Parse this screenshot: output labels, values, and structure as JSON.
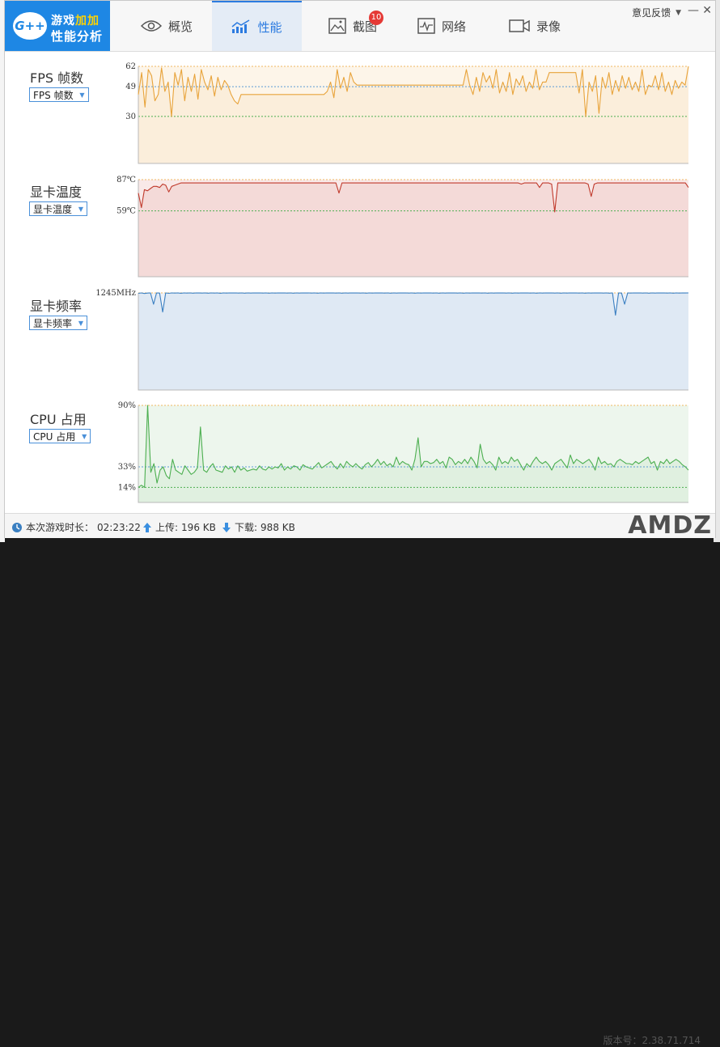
{
  "app": {
    "logo_badge": "G++",
    "logo_line1_a": "游戏",
    "logo_line1_b": "加加",
    "logo_line2": "性能分析"
  },
  "tabs": [
    {
      "label": "概览",
      "icon": "eye-icon"
    },
    {
      "label": "性能",
      "icon": "performance-chart-icon",
      "active": true
    },
    {
      "label": "截图",
      "icon": "screenshot-image-icon",
      "badge": "10"
    },
    {
      "label": "网络",
      "icon": "network-pulse-icon"
    },
    {
      "label": "录像",
      "icon": "video-camera-icon"
    }
  ],
  "header": {
    "feedback": "意见反馈",
    "minimize": "—",
    "close": "✕"
  },
  "sections": [
    {
      "label": "FPS 帧数",
      "select": "FPS 帧数",
      "color": "#e8a33a",
      "fill": "#fdf5e9",
      "refs": [
        {
          "label": "62",
          "value": 62,
          "color": "#f0b860"
        },
        {
          "label": "49",
          "value": 49,
          "color": "#5b9bd5"
        },
        {
          "label": "30",
          "value": 30,
          "color": "#4caf50"
        }
      ],
      "ylim": [
        0,
        62
      ],
      "values": [
        44,
        58,
        36,
        60,
        56,
        40,
        44,
        61,
        46,
        52,
        30,
        58,
        50,
        60,
        40,
        55,
        46,
        57,
        41,
        60,
        52,
        47,
        56,
        43,
        55,
        47,
        53,
        50,
        44,
        40,
        38,
        44,
        44,
        44,
        44,
        44,
        44,
        44,
        44,
        44,
        44,
        44,
        44,
        44,
        44,
        44,
        44,
        44,
        44,
        44,
        44,
        44,
        44,
        44,
        44,
        44,
        44,
        46,
        52,
        42,
        60,
        48,
        55,
        46,
        58,
        52,
        50,
        50,
        50,
        50,
        50,
        50,
        50,
        50,
        50,
        50,
        50,
        50,
        50,
        50,
        50,
        50,
        50,
        50,
        50,
        50,
        50,
        50,
        50,
        50,
        50,
        50,
        50,
        50,
        50,
        50,
        50,
        50,
        50,
        60,
        50,
        44,
        55,
        46,
        58,
        52,
        56,
        48,
        60,
        45,
        52,
        46,
        58,
        44,
        54,
        50,
        56,
        46,
        52,
        48,
        60,
        47,
        52,
        52,
        58,
        58,
        58,
        58,
        58,
        58,
        58,
        58,
        58,
        45,
        60,
        30,
        52,
        46,
        56,
        32,
        55,
        48,
        58,
        44,
        53,
        46,
        56,
        48,
        55,
        47,
        52,
        46,
        60,
        44,
        50,
        49,
        56,
        47,
        58,
        46,
        52,
        44,
        53,
        48,
        52,
        50,
        62
      ]
    },
    {
      "label": "显卡温度",
      "select": "显卡温度",
      "color": "#c0392b",
      "fill": "#f9e9e8",
      "refs": [
        {
          "label": "87℃",
          "value": 87,
          "color": "#f0b860"
        },
        {
          "label": "59℃",
          "value": 59,
          "color": "#4caf50"
        }
      ],
      "ylim": [
        0,
        87
      ],
      "values": [
        75,
        62,
        78,
        77,
        79,
        81,
        81,
        80,
        83,
        82,
        76,
        81,
        82,
        83,
        84,
        84,
        84,
        84,
        84,
        84,
        84,
        84,
        84,
        84,
        84,
        84,
        84,
        84,
        84,
        84,
        84,
        84,
        84,
        84,
        84,
        84,
        84,
        84,
        84,
        84,
        84,
        84,
        84,
        84,
        84,
        84,
        84,
        84,
        84,
        84,
        84,
        84,
        84,
        84,
        84,
        84,
        84,
        84,
        84,
        84,
        84,
        84,
        84,
        84,
        84,
        84,
        75,
        84,
        84,
        84,
        84,
        84,
        84,
        84,
        84,
        84,
        84,
        84,
        84,
        84,
        84,
        84,
        84,
        84,
        84,
        84,
        84,
        84,
        84,
        84,
        84,
        84,
        84,
        84,
        84,
        84,
        84,
        84,
        84,
        84,
        84,
        84,
        84,
        84,
        84,
        84,
        84,
        84,
        84,
        84,
        84,
        84,
        84,
        84,
        84,
        84,
        84,
        84,
        84,
        84,
        84,
        84,
        84,
        84,
        84,
        84,
        83,
        84,
        84,
        84,
        84,
        84,
        80,
        84,
        84,
        84,
        83,
        58,
        84,
        84,
        84,
        84,
        84,
        84,
        84,
        84,
        84,
        84,
        83,
        72,
        83,
        84,
        84,
        84,
        84,
        84,
        84,
        84,
        84,
        84,
        84,
        84,
        84,
        84,
        84,
        84,
        84,
        84,
        84,
        84,
        84,
        84,
        84,
        84,
        84,
        84,
        84,
        84,
        84,
        84,
        84,
        80
      ]
    },
    {
      "label": "显卡频率",
      "select": "显卡频率",
      "color": "#3a7fc1",
      "fill": "#edf2f9",
      "refs": [
        {
          "label": "1245MHz",
          "value": 1245,
          "color": "#f0b860"
        }
      ],
      "ylim": [
        0,
        1245
      ],
      "values": [
        1240,
        1245,
        1238,
        1243,
        1245,
        1100,
        1245,
        1243,
        1000,
        1245,
        1240,
        1245,
        1243,
        1245,
        1241,
        1245,
        1243,
        1245,
        1242,
        1245,
        1244,
        1243,
        1245,
        1242,
        1245,
        1243,
        1245,
        1241,
        1245,
        1243,
        1245,
        1244,
        1245,
        1243,
        1245,
        1242,
        1245,
        1243,
        1245,
        1244,
        1245,
        1243,
        1245,
        1242,
        1245,
        1243,
        1245,
        1244,
        1245,
        1243,
        1245,
        1242,
        1245,
        1243,
        1245,
        1244,
        1245,
        1243,
        1245,
        1242,
        1245,
        1243,
        1245,
        1244,
        1245,
        1243,
        1245,
        1242,
        1245,
        1243,
        1245,
        1244,
        1245,
        1243,
        1245,
        1242,
        1245,
        1243,
        1245,
        1244,
        1245,
        1243,
        1245,
        1242,
        1245,
        1243,
        1245,
        1244,
        1245,
        1243,
        1245,
        1242,
        1245,
        1243,
        1245,
        1244,
        1245,
        1243,
        1245,
        1242,
        1245,
        1243,
        1245,
        1244,
        1245,
        1243,
        1245,
        1242,
        1245,
        1243,
        1245,
        1244,
        1245,
        1243,
        1245,
        1242,
        1245,
        1243,
        1245,
        1244,
        1245,
        1243,
        1245,
        1242,
        1245,
        1243,
        1245,
        1244,
        1245,
        1243,
        1245,
        1242,
        1245,
        1243,
        1245,
        1244,
        1245,
        1243,
        1245,
        1242,
        1245,
        1243,
        1245,
        1244,
        1245,
        1243,
        1245,
        1242,
        1245,
        1243,
        1245,
        1244,
        1245,
        1243,
        1245,
        1242,
        1245,
        960,
        1245,
        1243,
        1100,
        1245,
        1243,
        1245,
        1244,
        1245,
        1243,
        1245,
        1242,
        1245,
        1243,
        1245,
        1244,
        1245,
        1243,
        1245,
        1242,
        1245,
        1243,
        1245,
        1244,
        1245
      ]
    },
    {
      "label": "CPU 占用",
      "select": "CPU 占用",
      "color": "#4caf50",
      "fill": "#edf6ed",
      "refs": [
        {
          "label": "90%",
          "value": 90,
          "color": "#f0b860"
        },
        {
          "label": "33%",
          "value": 33,
          "color": "#5b9bd5"
        },
        {
          "label": "14%",
          "value": 14,
          "color": "#4caf50"
        }
      ],
      "ylim": [
        0,
        90
      ],
      "values": [
        14,
        16,
        14,
        90,
        28,
        36,
        18,
        30,
        33,
        25,
        22,
        40,
        30,
        28,
        26,
        34,
        30,
        26,
        28,
        32,
        70,
        30,
        28,
        33,
        36,
        30,
        29,
        28,
        34,
        31,
        33,
        28,
        34,
        30,
        32,
        29,
        30,
        31,
        30,
        34,
        31,
        30,
        33,
        31,
        33,
        32,
        36,
        30,
        33,
        31,
        34,
        33,
        30,
        35,
        33,
        32,
        31,
        34,
        37,
        32,
        34,
        36,
        38,
        34,
        31,
        36,
        32,
        38,
        35,
        33,
        36,
        33,
        31,
        35,
        37,
        33,
        36,
        40,
        35,
        38,
        34,
        36,
        33,
        42,
        35,
        38,
        36,
        35,
        30,
        40,
        60,
        33,
        38,
        38,
        36,
        37,
        40,
        36,
        38,
        32,
        42,
        40,
        35,
        38,
        36,
        40,
        36,
        42,
        38,
        32,
        54,
        40,
        36,
        38,
        35,
        30,
        42,
        36,
        38,
        36,
        42,
        38,
        40,
        35,
        30,
        36,
        33,
        38,
        42,
        38,
        36,
        38,
        35,
        30,
        36,
        38,
        40,
        36,
        32,
        44,
        36,
        40,
        38,
        36,
        38,
        40,
        36,
        30,
        42,
        36,
        38,
        35,
        36,
        33,
        38,
        40,
        38,
        36,
        36,
        35,
        38,
        36,
        38,
        40,
        42,
        36,
        38,
        30,
        38,
        36,
        40,
        36,
        38,
        40,
        38,
        35,
        33,
        30
      ]
    }
  ],
  "footer": {
    "duration_label": "本次游戏时长：",
    "duration": "02:23:22",
    "upload_label": "上传: ",
    "upload": "196 KB",
    "download_label": "下载: ",
    "download": "988 KB",
    "version_label": "版本号：",
    "version": "2.38.71.714",
    "watermark": "AMDZ"
  }
}
